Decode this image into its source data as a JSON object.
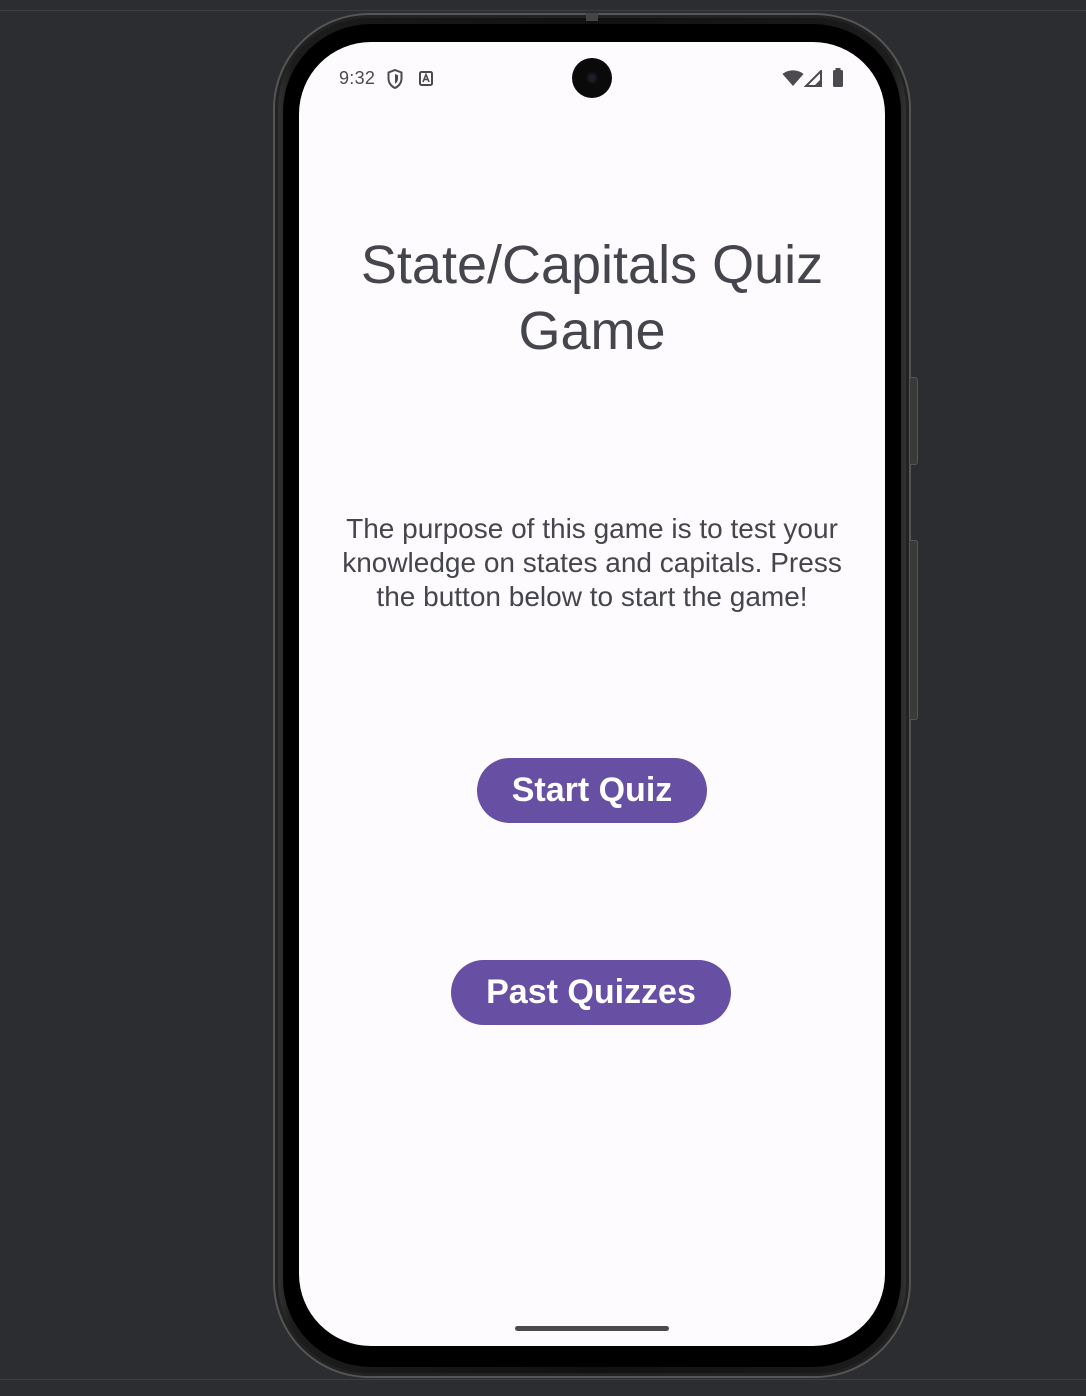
{
  "status_bar": {
    "time": "9:32",
    "icons": [
      "shield-icon",
      "accessibility-a-icon",
      "wifi-icon",
      "cell-signal-icon",
      "battery-icon"
    ]
  },
  "main": {
    "title": "State/Capitals Quiz Game",
    "description": "The purpose of this game is to test your knowledge on states and capitals. Press the button below to start the game!",
    "start_button_label": "Start Quiz",
    "past_button_label": "Past Quizzes"
  },
  "colors": {
    "background": "#2b2d31",
    "screen": "#fefbfe",
    "primary_button": "#6750a4",
    "text": "#45454d"
  }
}
